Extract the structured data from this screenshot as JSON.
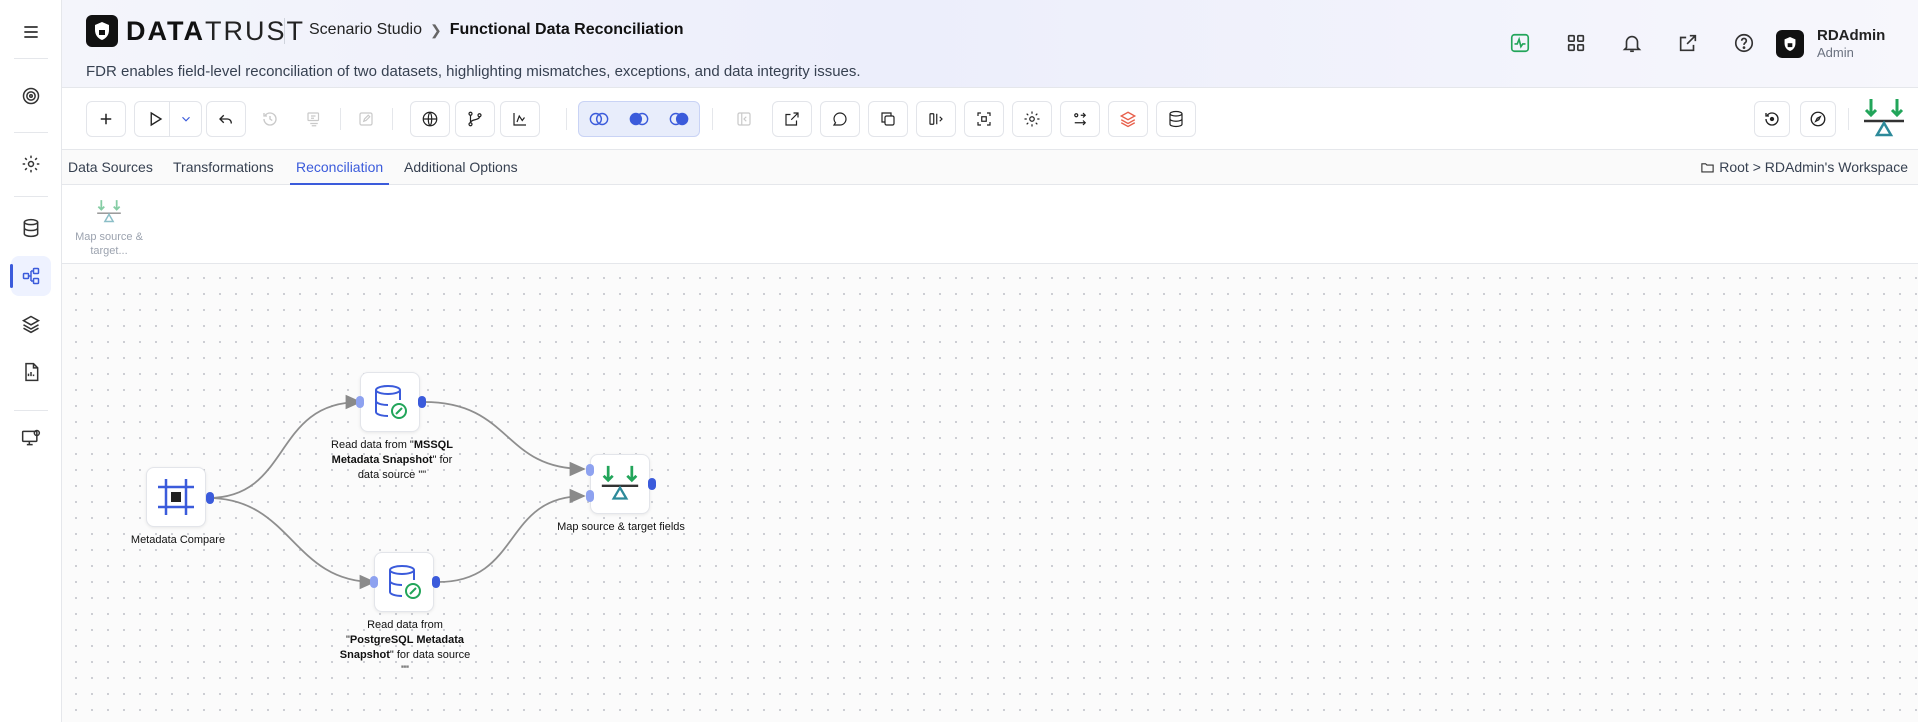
{
  "app": {
    "brand_bold": "DATA",
    "brand_thin": "TRUST",
    "breadcrumb": [
      "Scenario Studio",
      "Functional Data Reconciliation"
    ],
    "description": "FDR enables field-level reconciliation of two datasets, highlighting mismatches, exceptions, and data integrity issues."
  },
  "header_icons": [
    "activity-icon",
    "apps-grid-icon",
    "bell-icon",
    "external-link-icon",
    "help-icon"
  ],
  "user": {
    "name": "RDAdmin",
    "role": "Admin"
  },
  "rail": [
    "menu-icon",
    "target-icon",
    "settings-icon",
    "database-icon",
    "workflow-icon",
    "layers-icon",
    "report-icon",
    "monitor-icon"
  ],
  "tabs": [
    {
      "label": "Data Sources",
      "active": false
    },
    {
      "label": "Transformations",
      "active": false
    },
    {
      "label": "Reconciliation",
      "active": true
    },
    {
      "label": "Additional Options",
      "active": false
    }
  ],
  "workspace_path": "Root > RDAdmin's Workspace",
  "palette": [
    {
      "label": "Map source & target..."
    }
  ],
  "nodes": {
    "metadata_compare": {
      "label": "Metadata Compare"
    },
    "mssql": {
      "prefix": "Read data from \"",
      "name": "MSSQL Metadata Snapshot",
      "suffix": "\" for data source \"\""
    },
    "postgres": {
      "prefix": "Read data from \"",
      "name": "PostgreSQL Metadata Snapshot",
      "suffix": "\" for data source \"\""
    },
    "map_fields": {
      "label": "Map source & target fields"
    }
  },
  "colors": {
    "accent": "#3b5bdb",
    "green": "#22a55a",
    "teal": "#2d8a9a"
  }
}
